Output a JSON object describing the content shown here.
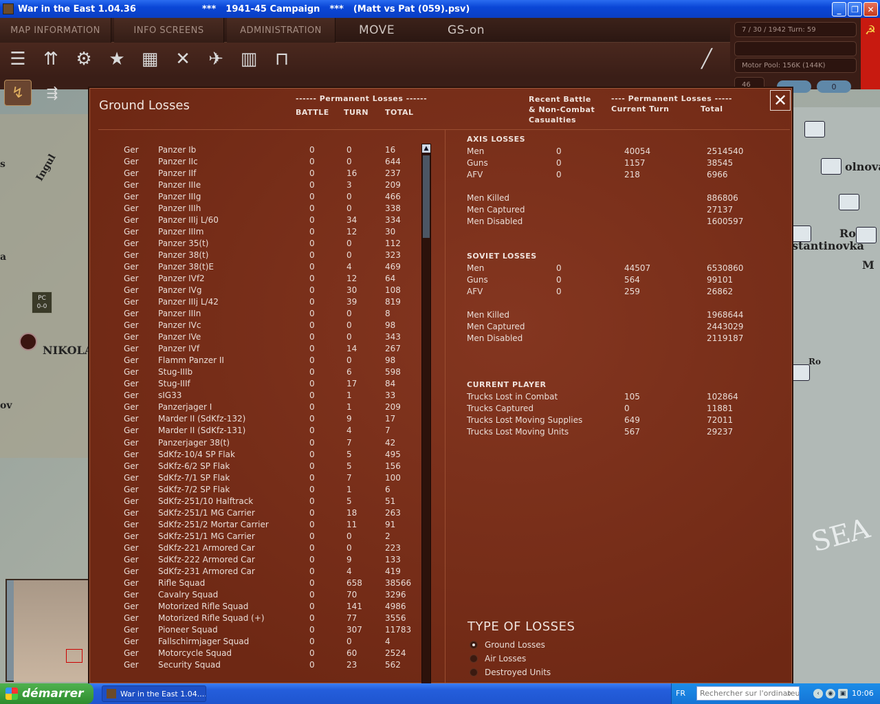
{
  "window": {
    "title_app": "War in the East 1.04.36",
    "title_sep1": "***",
    "title_campaign": "1941-45 Campaign",
    "title_sep2": "***",
    "title_file": "(Matt vs Pat (059).psv)"
  },
  "menu": {
    "tabs": [
      "MAP INFORMATION",
      "INFO SCREENS",
      "ADMINISTRATION"
    ],
    "move": "MOVE",
    "gs": "GS-on"
  },
  "info": {
    "date_turn": "7 / 30 / 1942     Turn: 59",
    "motor_pool": "Motor Pool:  156K (144K)",
    "turn_num": "46",
    "pill2": "0"
  },
  "map": {
    "labels": [
      "Ingul",
      "NIKOLA",
      "Ro",
      "stantinovka",
      "olnova",
      "M",
      "SEA",
      "ov",
      "Ro",
      "a",
      "s"
    ],
    "pc_label": "PC",
    "pc_value": "0-0"
  },
  "dialog": {
    "title": "Ground Losses",
    "hdr_perm_left": "------ Permanent Losses ------",
    "hdr_battle": "BATTLE",
    "hdr_turn": "TURN",
    "hdr_total": "TOTAL",
    "hdr_recent": "Recent Battle\n& Non-Combat\nCasualties",
    "hdr_perm_right": "---- Permanent Losses -----",
    "hdr_current_turn": "Current Turn",
    "hdr_total2": "Total",
    "close_icon": "close-x",
    "units": [
      [
        "Ger",
        "Panzer Ib",
        "0",
        "0",
        "16"
      ],
      [
        "Ger",
        "Panzer IIc",
        "0",
        "0",
        "644"
      ],
      [
        "Ger",
        "Panzer IIf",
        "0",
        "16",
        "237"
      ],
      [
        "Ger",
        "Panzer IIIe",
        "0",
        "3",
        "209"
      ],
      [
        "Ger",
        "Panzer IIIg",
        "0",
        "0",
        "466"
      ],
      [
        "Ger",
        "Panzer IIIh",
        "0",
        "0",
        "338"
      ],
      [
        "Ger",
        "Panzer IIIj L/60",
        "0",
        "34",
        "334"
      ],
      [
        "Ger",
        "Panzer IIIm",
        "0",
        "12",
        "30"
      ],
      [
        "Ger",
        "Panzer 35(t)",
        "0",
        "0",
        "112"
      ],
      [
        "Ger",
        "Panzer 38(t)",
        "0",
        "0",
        "323"
      ],
      [
        "Ger",
        "Panzer 38(t)E",
        "0",
        "4",
        "469"
      ],
      [
        "Ger",
        "Panzer IVf2",
        "0",
        "12",
        "64"
      ],
      [
        "Ger",
        "Panzer IVg",
        "0",
        "30",
        "108"
      ],
      [
        "Ger",
        "Panzer IIIj L/42",
        "0",
        "39",
        "819"
      ],
      [
        "Ger",
        "Panzer IIIn",
        "0",
        "0",
        "8"
      ],
      [
        "Ger",
        "Panzer IVc",
        "0",
        "0",
        "98"
      ],
      [
        "Ger",
        "Panzer IVe",
        "0",
        "0",
        "343"
      ],
      [
        "Ger",
        "Panzer IVf",
        "0",
        "14",
        "267"
      ],
      [
        "Ger",
        "Flamm Panzer II",
        "0",
        "0",
        "98"
      ],
      [
        "Ger",
        "Stug-IIIb",
        "0",
        "6",
        "598"
      ],
      [
        "Ger",
        "Stug-IIIf",
        "0",
        "17",
        "84"
      ],
      [
        "Ger",
        "sIG33",
        "0",
        "1",
        "33"
      ],
      [
        "Ger",
        "Panzerjager I",
        "0",
        "1",
        "209"
      ],
      [
        "Ger",
        "Marder II (SdKfz-132)",
        "0",
        "9",
        "17"
      ],
      [
        "Ger",
        "Marder II (SdKfz-131)",
        "0",
        "4",
        "7"
      ],
      [
        "Ger",
        "Panzerjager 38(t)",
        "0",
        "7",
        "42"
      ],
      [
        "Ger",
        "SdKfz-10/4 SP Flak",
        "0",
        "5",
        "495"
      ],
      [
        "Ger",
        "SdKfz-6/2 SP Flak",
        "0",
        "5",
        "156"
      ],
      [
        "Ger",
        "SdKfz-7/1 SP Flak",
        "0",
        "7",
        "100"
      ],
      [
        "Ger",
        "SdKfz-7/2 SP Flak",
        "0",
        "1",
        "6"
      ],
      [
        "Ger",
        "SdKfz-251/10 Halftrack",
        "0",
        "5",
        "51"
      ],
      [
        "Ger",
        "SdKfz-251/1 MG Carrier",
        "0",
        "18",
        "263"
      ],
      [
        "Ger",
        "SdKfz-251/2 Mortar Carrier",
        "0",
        "11",
        "91"
      ],
      [
        "Ger",
        "SdKfz-251/1 MG Carrier",
        "0",
        "0",
        "2"
      ],
      [
        "Ger",
        "SdKfz-221 Armored Car",
        "0",
        "0",
        "223"
      ],
      [
        "Ger",
        "SdKfz-222 Armored Car",
        "0",
        "9",
        "133"
      ],
      [
        "Ger",
        "SdKfz-231 Armored Car",
        "0",
        "4",
        "419"
      ],
      [
        "Ger",
        "Rifle Squad",
        "0",
        "658",
        "38566"
      ],
      [
        "Ger",
        "Cavalry Squad",
        "0",
        "70",
        "3296"
      ],
      [
        "Ger",
        "Motorized Rifle Squad",
        "0",
        "141",
        "4986"
      ],
      [
        "Ger",
        "Motorized Rifle Squad (+)",
        "0",
        "77",
        "3556"
      ],
      [
        "Ger",
        "Pioneer Squad",
        "0",
        "307",
        "11783"
      ],
      [
        "Ger",
        "Fallschirmjager Squad",
        "0",
        "0",
        "4"
      ],
      [
        "Ger",
        "Motorcycle Squad",
        "0",
        "60",
        "2524"
      ],
      [
        "Ger",
        "Security Squad",
        "0",
        "23",
        "562"
      ]
    ],
    "axis_title": "AXIS LOSSES",
    "axis_rows": [
      [
        "Men",
        "0",
        "40054",
        "2514540"
      ],
      [
        "Guns",
        "0",
        "1157",
        "38545"
      ],
      [
        "AFV",
        "0",
        "218",
        "6966"
      ]
    ],
    "axis_detail": [
      [
        "Men Killed",
        "886806"
      ],
      [
        "Men Captured",
        "27137"
      ],
      [
        "Men Disabled",
        "1600597"
      ]
    ],
    "soviet_title": "SOVIET LOSSES",
    "soviet_rows": [
      [
        "Men",
        "0",
        "44507",
        "6530860"
      ],
      [
        "Guns",
        "0",
        "564",
        "99101"
      ],
      [
        "AFV",
        "0",
        "259",
        "26862"
      ]
    ],
    "soviet_detail": [
      [
        "Men Killed",
        "1968644"
      ],
      [
        "Men Captured",
        "2443029"
      ],
      [
        "Men Disabled",
        "2119187"
      ]
    ],
    "player_title": "CURRENT PLAYER",
    "player_rows": [
      [
        "Trucks Lost in Combat",
        "105",
        "102864"
      ],
      [
        "Trucks Captured",
        "0",
        "11881"
      ],
      [
        "Trucks Lost Moving Supplies",
        "649",
        "72011"
      ],
      [
        "Trucks Lost Moving Units",
        "567",
        "29237"
      ]
    ],
    "loss_type_title": "TYPE OF LOSSES",
    "loss_types": [
      "Ground Losses",
      "Air Losses",
      "Destroyed Units"
    ],
    "loss_type_selected": "Ground Losses"
  },
  "taskbar": {
    "start": "démarrer",
    "task": "War in the East 1.04....",
    "lang": "FR",
    "search_placeholder": "Rechercher sur l'ordinateur",
    "clock": "10:06"
  }
}
